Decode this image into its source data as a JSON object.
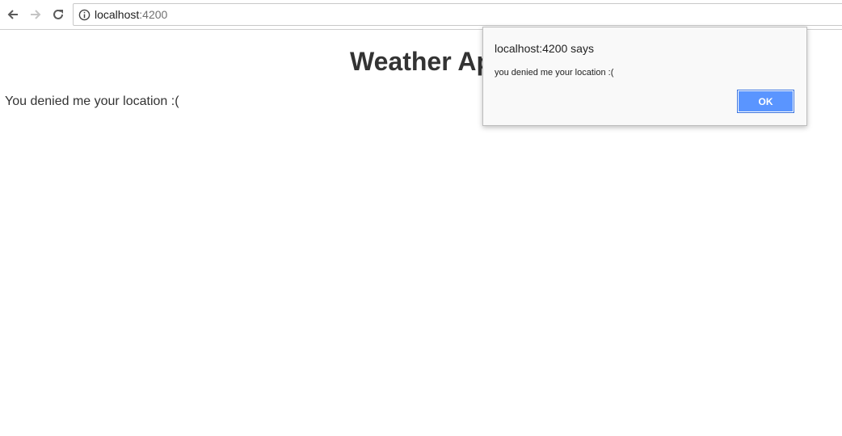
{
  "browser": {
    "url_host": "localhost",
    "url_port": ":4200",
    "icons": {
      "back": "arrow-left-icon",
      "forward": "arrow-right-icon",
      "reload": "reload-icon",
      "info": "info-icon"
    }
  },
  "page": {
    "title": "Weather Ap",
    "message": "You denied me your location :("
  },
  "dialog": {
    "title": "localhost:4200 says",
    "message": "you denied me your location :(",
    "ok_label": "OK"
  },
  "colors": {
    "ok_button": "#5a95ff",
    "text": "#333333",
    "dialog_bg": "#f9f9f9"
  }
}
